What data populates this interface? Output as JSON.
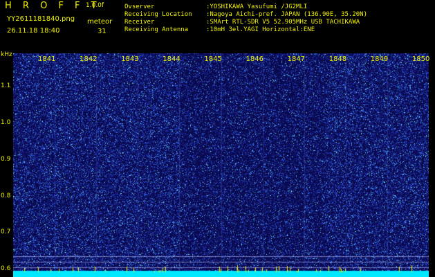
{
  "header": {
    "logo": "H R O F F T",
    "version": "1.0.0f",
    "filename": "YY2611181840.png",
    "datetime": "26.11.18 18:40",
    "meteor_label": "meteor",
    "meteor_count": "31"
  },
  "info": [
    {
      "key": "Ovserver",
      "value": ":YOSHIKAWA Yasufumi /JG2MLI"
    },
    {
      "key": "Receiving Location",
      "value": ":Nagoya Aichi-pref. JAPAN (136.90E, 35.20N)"
    },
    {
      "key": "Receiver",
      "value": ":SMArt RTL-SDR V5 52.905MHz USB TACHIKAWA"
    },
    {
      "key": "Receiving Antenna",
      "value": ":10mH 3el.YAGI Horizontal:ENE"
    }
  ],
  "chart_data": {
    "type": "heatmap",
    "ylabel": "kHz",
    "x_ticks": [
      "1841",
      "1842",
      "1843",
      "1844",
      "1845",
      "1846",
      "1847",
      "1848",
      "1849",
      "1850"
    ],
    "y_ticks": [
      "1.1",
      "1.0",
      "0.9",
      "0.8",
      "0.7",
      "0.6"
    ],
    "y_values": [
      1.1,
      1.0,
      0.9,
      0.8,
      0.7,
      0.6
    ],
    "ylim": [
      0.58,
      1.19
    ],
    "colors": {
      "background": "#0a0a50",
      "noise": "#2a3cc8",
      "noise_bright": "#3ca0ff",
      "highlight": "#7affff",
      "baseline": "#00e8ff",
      "marker": "#f2f200",
      "text": "#f2f200"
    }
  }
}
